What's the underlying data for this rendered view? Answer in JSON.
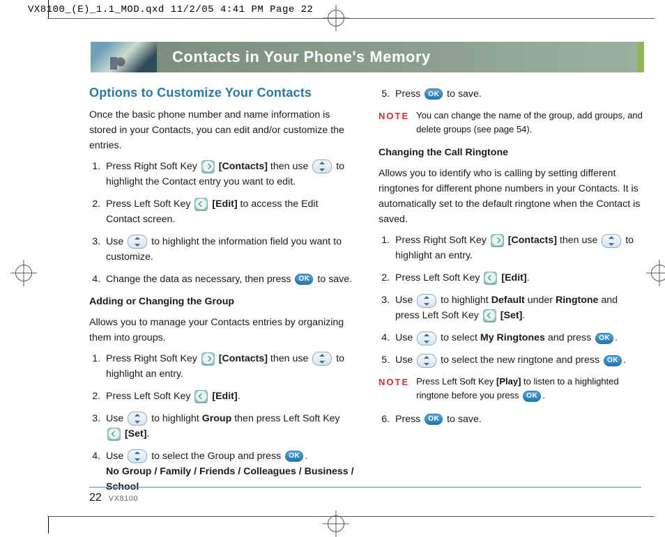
{
  "print_header": "VX8100_(E)_1.1_MOD.qxd  11/2/05  4:41 PM  Page 22",
  "banner_title": "Contacts in Your Phone's Memory",
  "section_title": "Options to Customize Your Contacts",
  "intro": "Once the basic phone number and name information is stored in your Contacts, you can edit and/or customize the entries.",
  "left_steps": {
    "s1a": "Press Right Soft Key ",
    "s1b": " [Contacts]",
    "s1c": " then use ",
    "s1d": " to highlight the Contact entry you want to edit.",
    "s2a": "Press Left Soft Key ",
    "s2b": " [Edit]",
    "s2c": " to access the Edit Contact screen.",
    "s3a": "Use ",
    "s3b": " to highlight the information field you want to customize.",
    "s4a": "Change the data as necessary, then press ",
    "s4b": " to save."
  },
  "group_heading": "Adding or Changing the Group",
  "group_intro": "Allows you to manage your Contacts entries by organizing them into groups.",
  "group_steps": {
    "g1a": "Press Right Soft Key ",
    "g1b": " [Contacts]",
    "g1c": " then use ",
    "g1d": " to highlight an entry.",
    "g2a": "Press Left Soft Key ",
    "g2b": " [Edit]",
    "g2c": ".",
    "g3a": "Use ",
    "g3b": " to highlight ",
    "g3c": "Group",
    "g3d": " then press Left Soft Key ",
    "g3e": " [Set]",
    "g3f": ".",
    "g4a": "Use ",
    "g4b": " to select the Group and press ",
    "g4c": ".",
    "g4_groups": "No Group / Family / Friends / Colleagues / Business / School"
  },
  "right": {
    "r5a": "Press ",
    "r5b": " to save.",
    "note1": "You can change the name of the group, add groups, and delete groups (see page 54).",
    "ring_heading": "Changing the Call Ringtone",
    "ring_intro": "Allows you to identify who is calling by setting different ringtones for different phone numbers in your Contacts. It is automatically set to the default ringtone when the Contact is saved.",
    "c1a": "Press Right Soft Key ",
    "c1b": " [Contacts]",
    "c1c": " then use ",
    "c1d": " to highlight an entry.",
    "c2a": "Press Left Soft Key ",
    "c2b": " [Edit]",
    "c2c": ".",
    "c3a": "Use ",
    "c3b": " to highlight ",
    "c3c": "Default",
    "c3d": " under ",
    "c3e": "Ringtone",
    "c3f": " and press Left Soft Key ",
    "c3g": " [Set]",
    "c3h": ".",
    "c4a": "Use ",
    "c4b": " to select ",
    "c4c": "My Ringtones",
    "c4d": " and press ",
    "c4e": ".",
    "c5a": "Use ",
    "c5b": " to select the new ringtone and press ",
    "c5c": ".",
    "note2a": "Press Left Soft Key ",
    "note2b": "[Play]",
    "note2c": " to listen to a highlighted ringtone before you press ",
    "note2d": ".",
    "c6a": "Press ",
    "c6b": " to save."
  },
  "ok_label": "OK",
  "note_label": "NOTE",
  "footer": {
    "page": "22",
    "model": "VX8100"
  }
}
